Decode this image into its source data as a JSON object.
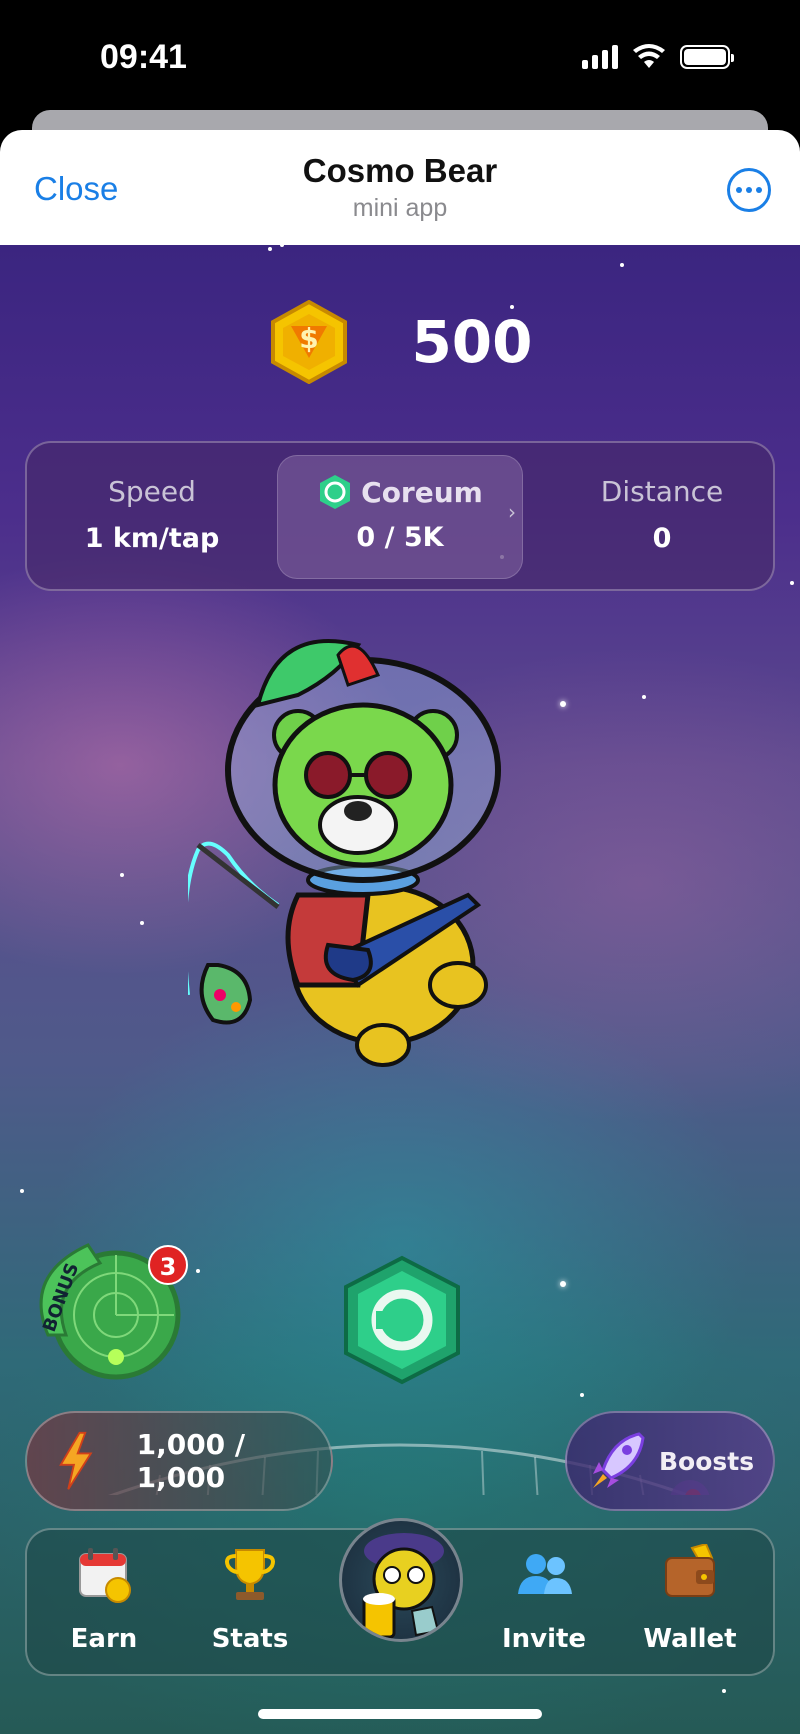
{
  "status_bar": {
    "time": "09:41"
  },
  "header": {
    "close_label": "Close",
    "title": "Cosmo Bear",
    "subtitle": "mini app",
    "more_icon": "more-icon"
  },
  "balance": {
    "value": "500",
    "icon": "dollar-coin-icon"
  },
  "stats": {
    "speed": {
      "label": "Speed",
      "value": "1 km/tap"
    },
    "coreum": {
      "label": "Coreum",
      "value": "0 / 5K"
    },
    "distance": {
      "label": "Distance",
      "value": "0"
    }
  },
  "bonus": {
    "label": "BONUS",
    "badge_count": "3"
  },
  "energy": {
    "value": "1,000 / 1,000",
    "icon": "lightning-icon"
  },
  "boosts": {
    "label": "Boosts",
    "icon": "rocket-icon"
  },
  "nav": {
    "items": [
      {
        "label": "Earn",
        "icon": "calendar-icon"
      },
      {
        "label": "Stats",
        "icon": "trophy-icon"
      },
      {
        "label": "",
        "icon": "bear-avatar-icon"
      },
      {
        "label": "Invite",
        "icon": "users-icon"
      },
      {
        "label": "Wallet",
        "icon": "wallet-icon"
      }
    ]
  },
  "colors": {
    "accent_blue": "#1a7fe6",
    "coin_gold": "#f5c400",
    "coreum_green": "#2ecf8a",
    "badge_red": "#e02323"
  }
}
